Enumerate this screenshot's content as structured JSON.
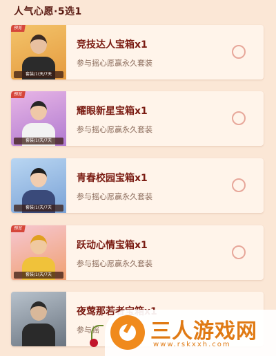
{
  "header": {
    "title": "人气心愿·5选1"
  },
  "items": [
    {
      "title": "竞技达人宝箱x1",
      "subtitle": "参与摇心愿赢永久套装",
      "tag": "预览",
      "duration": "套装/1(天/7天",
      "theme": {
        "bg1": "#f3c46b",
        "bg2": "#e59a3e",
        "head": "#e8c0a0",
        "hair": "#3a2a22",
        "body": "#2b2b2b"
      }
    },
    {
      "title": "耀眼新星宝箱x1",
      "subtitle": "参与摇心愿赢永久套装",
      "tag": "预览",
      "duration": "套装/1(天/7天",
      "theme": {
        "bg1": "#e8b6e6",
        "bg2": "#b07ad0",
        "head": "#efc8a8",
        "hair": "#262626",
        "body": "#f2f2f2"
      }
    },
    {
      "title": "青春校园宝箱x1",
      "subtitle": "参与摇心愿赢永久套装",
      "tag": "",
      "duration": "套装/1(天/7天",
      "theme": {
        "bg1": "#b9d6f2",
        "bg2": "#7aa2d6",
        "head": "#f1cdb0",
        "hair": "#1e1e1e",
        "body": "#3a4a7a"
      }
    },
    {
      "title": "跃动心情宝箱x1",
      "subtitle": "参与摇心愿赢永久套装",
      "tag": "预览",
      "duration": "套装/1(天/7天",
      "theme": {
        "bg1": "#f6c7d2",
        "bg2": "#f0a070",
        "head": "#f0c9a0",
        "hair": "#e0a020",
        "body": "#f0c23a"
      }
    },
    {
      "title": "夜莺那若者宝箱x1",
      "subtitle": "参与摇",
      "tag": "",
      "duration": "",
      "theme": {
        "bg1": "#b8c2cc",
        "bg2": "#6a7480",
        "head": "#d9b89a",
        "hair": "#2a2a2a",
        "body": "#2a2a2a"
      }
    }
  ],
  "watermark": {
    "name": "三人游戏网",
    "url": "www.rskxxh.com",
    "color": "#e07a14"
  }
}
